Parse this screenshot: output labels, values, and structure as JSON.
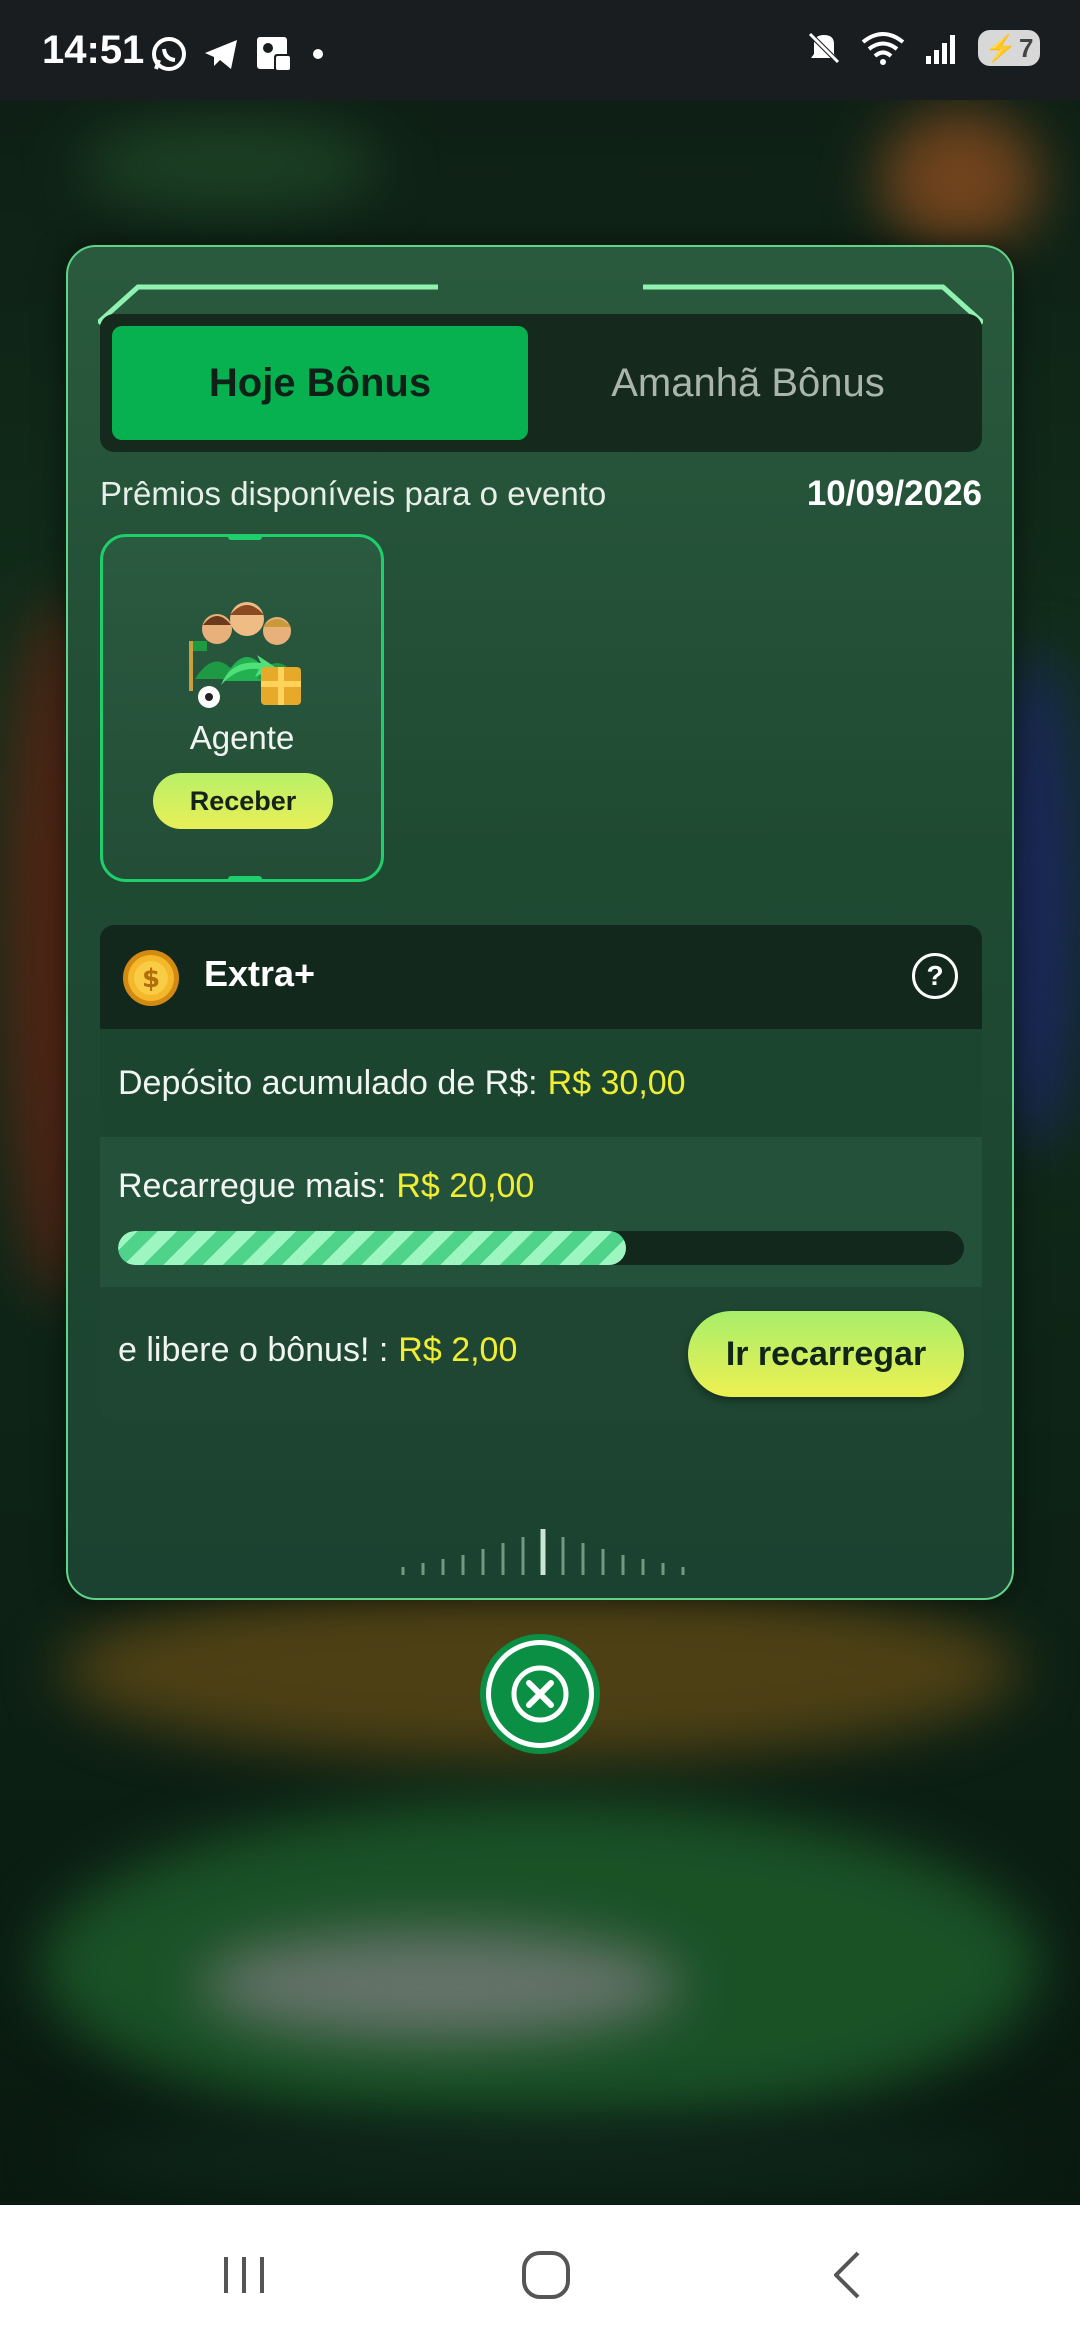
{
  "status_bar": {
    "time": "14:51",
    "left_icons": [
      "whatsapp-icon",
      "telegram-icon",
      "facebook-gallery-icon",
      "dot-icon"
    ],
    "right_icons": [
      "mute-icon",
      "wifi-icon",
      "signal-icon"
    ],
    "battery_level": "7"
  },
  "modal": {
    "tabs": [
      {
        "label": "Hoje Bônus",
        "active": true
      },
      {
        "label": "Amanhã Bônus",
        "active": false
      }
    ],
    "event_label": "Prêmios disponíveis para o evento",
    "event_date": "10/09/2026",
    "reward_card": {
      "icon": "agent-team-gift-icon",
      "label": "Agente",
      "button_label": "Receber"
    },
    "extra": {
      "title": "Extra+",
      "deposit_label": "Depósito acumulado de R$:",
      "deposit_value": "R$ 30,00",
      "recharge_label": "Recarregue mais:",
      "recharge_value": "R$ 20,00",
      "progress_fraction": 0.6,
      "release_label": "e libere o bônus! :",
      "release_value": "R$ 2,00",
      "button_label": "Ir recarregar"
    }
  },
  "colors": {
    "accent_green": "#07b150",
    "border_green": "#5fd38a",
    "highlight_yellow": "#f0ee33",
    "button_gradient": [
      "#a8ee6a",
      "#eef052"
    ]
  }
}
